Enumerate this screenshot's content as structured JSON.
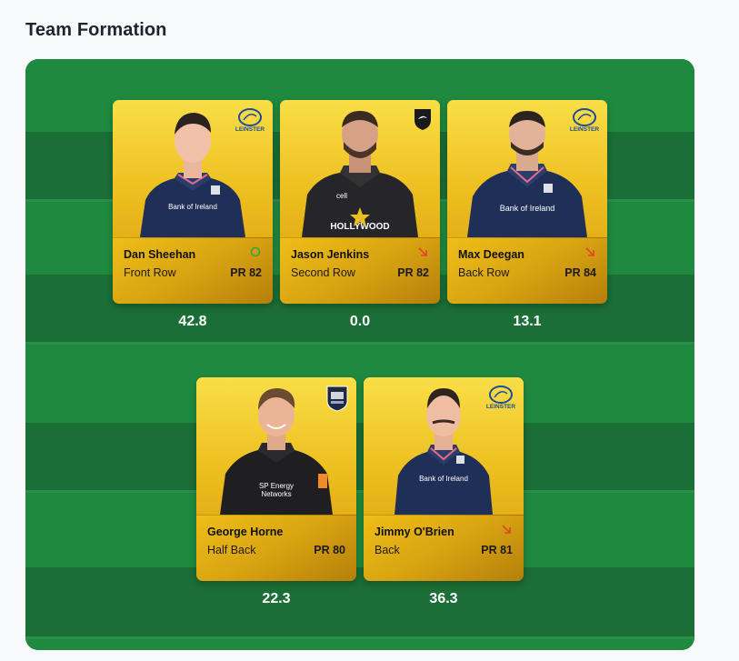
{
  "header": {
    "title": "Team Formation"
  },
  "team": {
    "players": [
      {
        "name": "Dan Sheehan",
        "position": "Front Row",
        "rating": "PR 82",
        "score": "42.8",
        "club": "Leinster",
        "club_badge_text": "LEINSTER",
        "trend": "neutral",
        "trend_icon": "circle-icon",
        "jersey": "navy",
        "sponsor": "Bank of Ireland"
      },
      {
        "name": "Jason Jenkins",
        "position": "Second Row",
        "rating": "PR 82",
        "score": "0.0",
        "club": "Sharks",
        "club_badge_text": "",
        "trend": "down",
        "trend_icon": "arrow-down-right-icon",
        "jersey": "black",
        "sponsor": "HOLLYWOOD"
      },
      {
        "name": "Max Deegan",
        "position": "Back Row",
        "rating": "PR 84",
        "score": "13.1",
        "club": "Leinster",
        "club_badge_text": "LEINSTER",
        "trend": "down",
        "trend_icon": "arrow-down-right-icon",
        "jersey": "navy",
        "sponsor": "Bank of Ireland"
      },
      {
        "name": "George Horne",
        "position": "Half Back",
        "rating": "PR 80",
        "score": "22.3",
        "club": "Glasgow Warriors",
        "club_badge_text": "",
        "trend": "none",
        "trend_icon": "",
        "jersey": "black",
        "sponsor": "SP Energy Networks"
      },
      {
        "name": "Jimmy O'Brien",
        "position": "Back",
        "rating": "PR 81",
        "score": "36.3",
        "club": "Leinster",
        "club_badge_text": "LEINSTER",
        "trend": "down",
        "trend_icon": "arrow-down-right-icon",
        "jersey": "navy",
        "sponsor": "Bank of Ireland"
      }
    ]
  },
  "colors": {
    "pitch_light": "#1f8a3f",
    "pitch_dark": "#1b6e36",
    "card_gold": "#e8b415",
    "trend_down": "#e0452b",
    "trend_neutral": "#3aa04a"
  }
}
